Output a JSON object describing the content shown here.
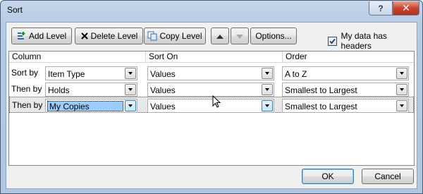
{
  "window": {
    "title": "Sort",
    "help_label": "?",
    "close_label": "✕"
  },
  "toolbar": {
    "add_level": "Add Level",
    "delete_level": "Delete Level",
    "copy_level": "Copy Level",
    "options": "Options...",
    "headers_checkbox_label": "My data has headers",
    "headers_checked": true
  },
  "grid": {
    "columns": [
      "Column",
      "Sort On",
      "Order"
    ],
    "rows": [
      {
        "label": "Sort by",
        "column": "Item Type",
        "sort_on": "Values",
        "order": "A to Z"
      },
      {
        "label": "Then by",
        "column": "Holds",
        "sort_on": "Values",
        "order": "Smallest to Largest"
      },
      {
        "label": "Then by",
        "column": "My Copies",
        "sort_on": "Values",
        "order": "Smallest to Largest"
      }
    ]
  },
  "footer": {
    "ok": "OK",
    "cancel": "Cancel"
  },
  "colors": {
    "selection": "#99ccff",
    "frame": "#b5c9e2",
    "close": "#c8452c"
  }
}
